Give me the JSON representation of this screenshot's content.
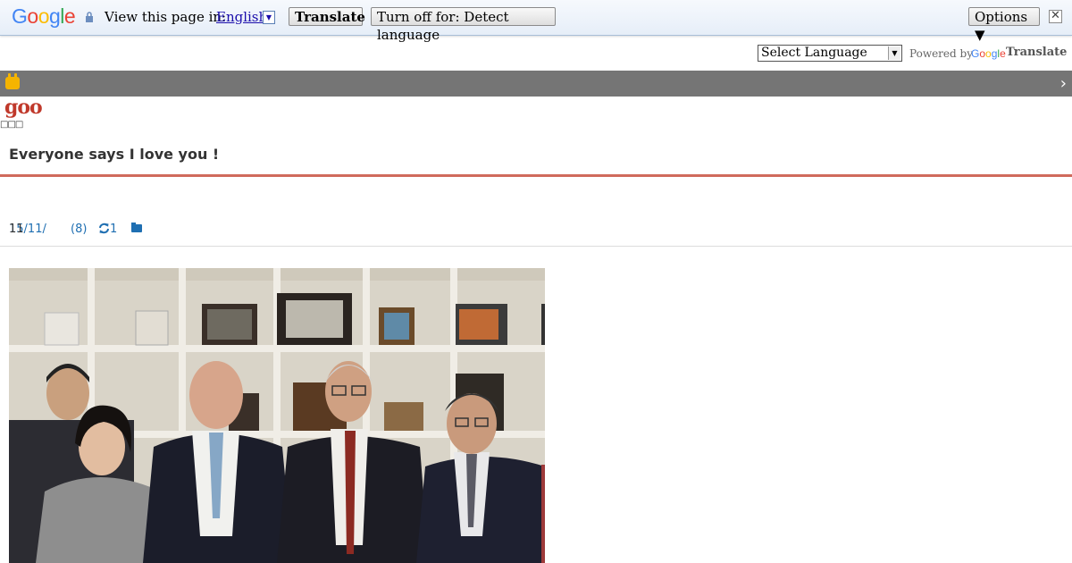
{
  "translate_bar": {
    "logo": "Google",
    "view_label": "View this page in:",
    "language": "English",
    "translate_button": "Translate",
    "turn_off_button": "Turn off for: Detect language",
    "options_button": "Options ▼",
    "close_glyph": "✕"
  },
  "language_widget": {
    "select_value": "Select Language",
    "powered_by": "Powered by",
    "google": "Google",
    "translate": "Translate"
  },
  "blog": {
    "logo": "goo",
    "tofu_text": "□□□",
    "title": "Everyone says I love you !"
  },
  "post_meta": {
    "date_prefix": "15/11/",
    "date_suffix": "11",
    "count": "(8)",
    "reblog_count": "1"
  },
  "colors": {
    "accent_red": "#d06a5c",
    "link_blue": "#1f6fb2",
    "strip_gray": "#757575"
  }
}
